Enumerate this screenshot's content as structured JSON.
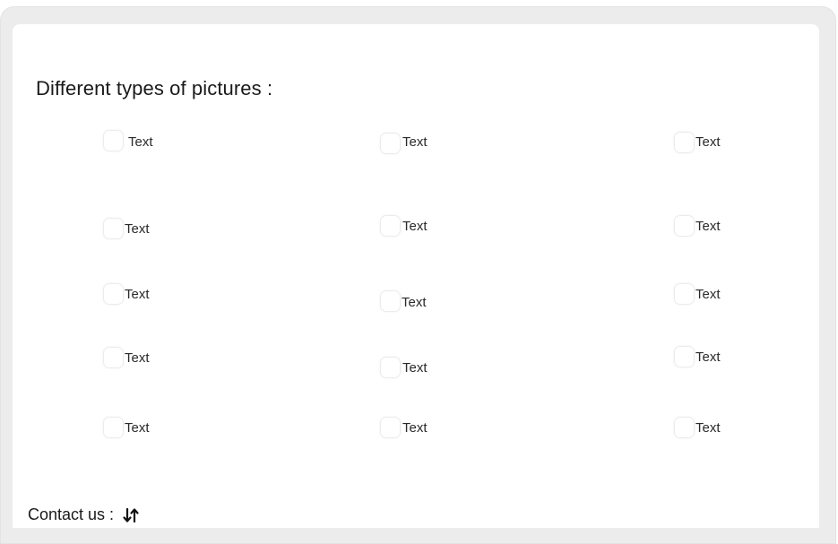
{
  "section": {
    "title": "Different types of pictures :"
  },
  "options": [
    {
      "label": "Text"
    },
    {
      "label": "Text"
    },
    {
      "label": "Text"
    },
    {
      "label": "Text"
    },
    {
      "label": "Text"
    },
    {
      "label": "Text"
    },
    {
      "label": "Text"
    },
    {
      "label": "Text"
    },
    {
      "label": "Text"
    },
    {
      "label": "Text"
    },
    {
      "label": "Text"
    },
    {
      "label": "Text"
    },
    {
      "label": "Text"
    },
    {
      "label": "Text"
    },
    {
      "label": "Text"
    }
  ],
  "footer": {
    "contact_label": "Contact us :",
    "contact_icon": "swap-vertical-icon"
  }
}
